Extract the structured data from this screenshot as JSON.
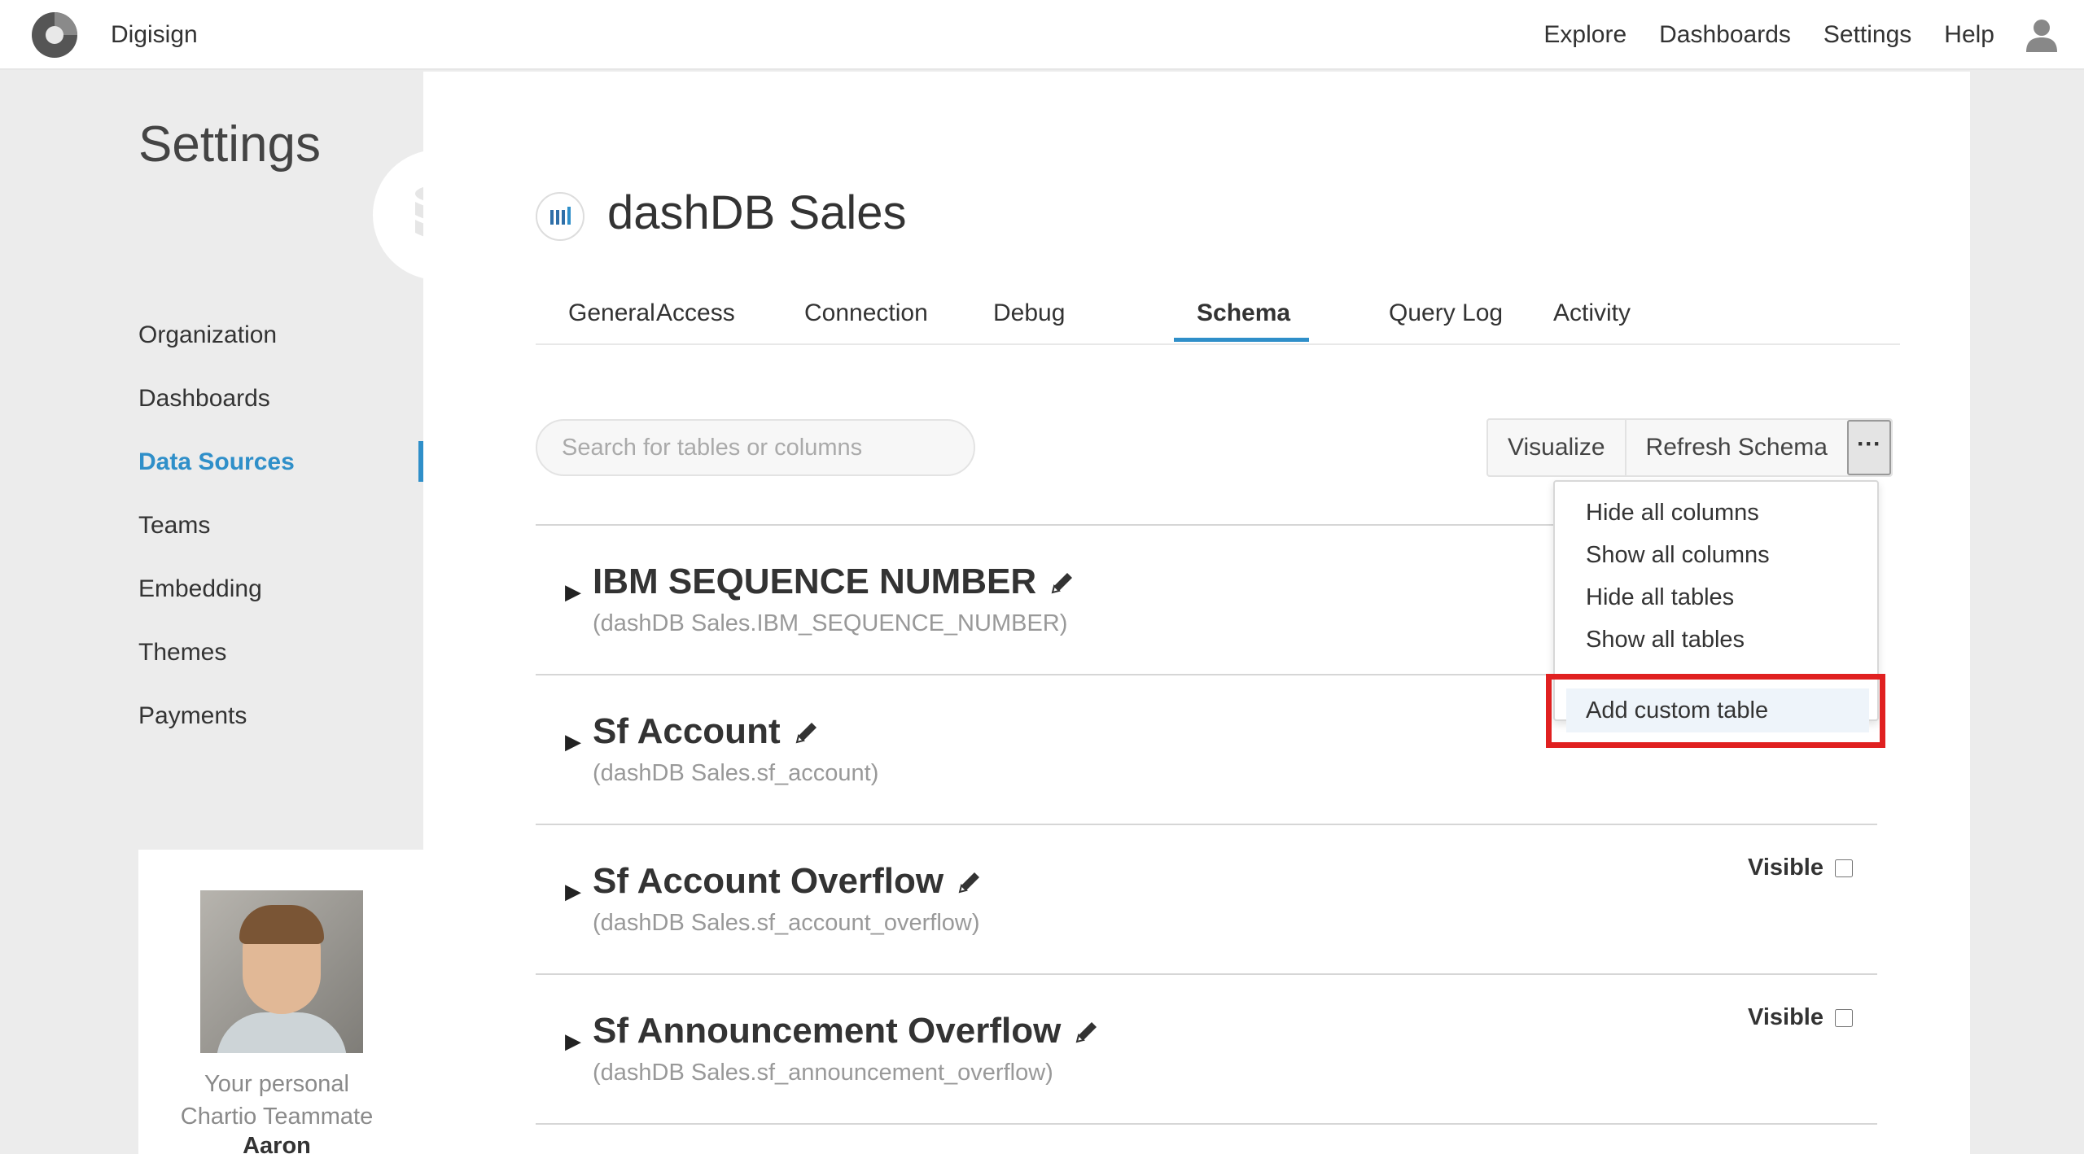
{
  "app": {
    "name": "Digisign"
  },
  "topnav": {
    "items": [
      "Explore",
      "Dashboards",
      "Settings",
      "Help"
    ]
  },
  "sidebar": {
    "title": "Settings",
    "items": [
      {
        "label": "Organization"
      },
      {
        "label": "Dashboards"
      },
      {
        "label": "Data Sources",
        "active": true
      },
      {
        "label": "Teams"
      },
      {
        "label": "Embedding"
      },
      {
        "label": "Themes"
      },
      {
        "label": "Payments"
      }
    ],
    "teammate": {
      "line1": "Your personal",
      "line2": "Chartio Teammate",
      "name": "Aaron"
    }
  },
  "datasource": {
    "title": "dashDB Sales"
  },
  "tabs": [
    {
      "label": "General"
    },
    {
      "label": "Access"
    },
    {
      "label": "Connection"
    },
    {
      "label": "Debug"
    },
    {
      "label": "Schema",
      "active": true
    },
    {
      "label": "Query Log"
    },
    {
      "label": "Activity"
    }
  ],
  "toolbar": {
    "search_placeholder": "Search for tables or columns",
    "visualize": "Visualize",
    "refresh": "Refresh Schema",
    "more": "···"
  },
  "dropdown": {
    "items": [
      "Hide all columns",
      "Show all columns",
      "Hide all tables",
      "Show all tables"
    ],
    "add_custom": "Add custom table"
  },
  "tables": [
    {
      "name": "IBM SEQUENCE NUMBER",
      "path": "(dashDB Sales.IBM_SEQUENCE_NUMBER)",
      "visible_label": ""
    },
    {
      "name": "Sf Account",
      "path": "(dashDB Sales.sf_account)",
      "visible_label": ""
    },
    {
      "name": "Sf Account Overflow",
      "path": "(dashDB Sales.sf_account_overflow)",
      "visible_label": "Visible"
    },
    {
      "name": "Sf Announcement Overflow",
      "path": "(dashDB Sales.sf_announcement_overflow)",
      "visible_label": "Visible"
    }
  ],
  "colors": {
    "accent": "#2f8fc9",
    "highlight_box": "#e02020"
  }
}
